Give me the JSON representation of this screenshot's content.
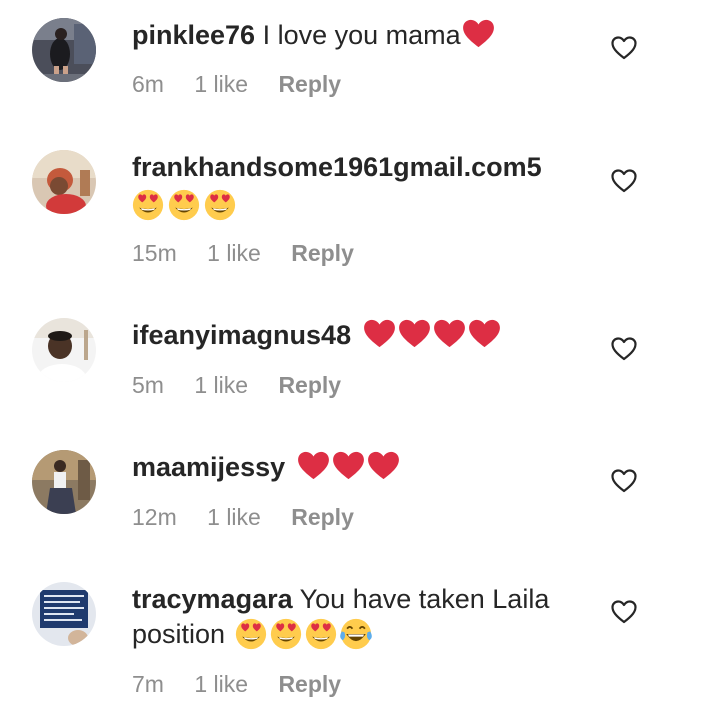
{
  "comments": [
    {
      "username": "pinklee76",
      "text": "I love you mama",
      "time": "6m",
      "likes": "1 like",
      "reply": "Reply",
      "emojis": [
        "red-heart"
      ]
    },
    {
      "username": "frankhandsome1961gmail.com5",
      "text": "",
      "time": "15m",
      "likes": "1 like",
      "reply": "Reply",
      "emojis": [
        "heart-eyes-face",
        "heart-eyes-face",
        "heart-eyes-face"
      ]
    },
    {
      "username": "ifeanyimagnus48",
      "text": "",
      "time": "5m",
      "likes": "1 like",
      "reply": "Reply",
      "emojis": [
        "red-heart",
        "red-heart",
        "red-heart",
        "red-heart"
      ]
    },
    {
      "username": "maamijessy",
      "text": "",
      "time": "12m",
      "likes": "1 like",
      "reply": "Reply",
      "emojis": [
        "red-heart",
        "red-heart",
        "red-heart"
      ]
    },
    {
      "username": "tracymagara",
      "text_line1": "You have taken Laila",
      "text_line2": "position",
      "time": "7m",
      "likes": "1 like",
      "reply": "Reply",
      "emojis": [
        "heart-eyes-face",
        "heart-eyes-face",
        "heart-eyes-face",
        "tears-of-joy-face"
      ]
    }
  ],
  "colors": {
    "username": "#262626",
    "meta": "#8e8e8e",
    "heart_red": "#dd2e44",
    "emoji_yellow": "#ffcc4d"
  }
}
